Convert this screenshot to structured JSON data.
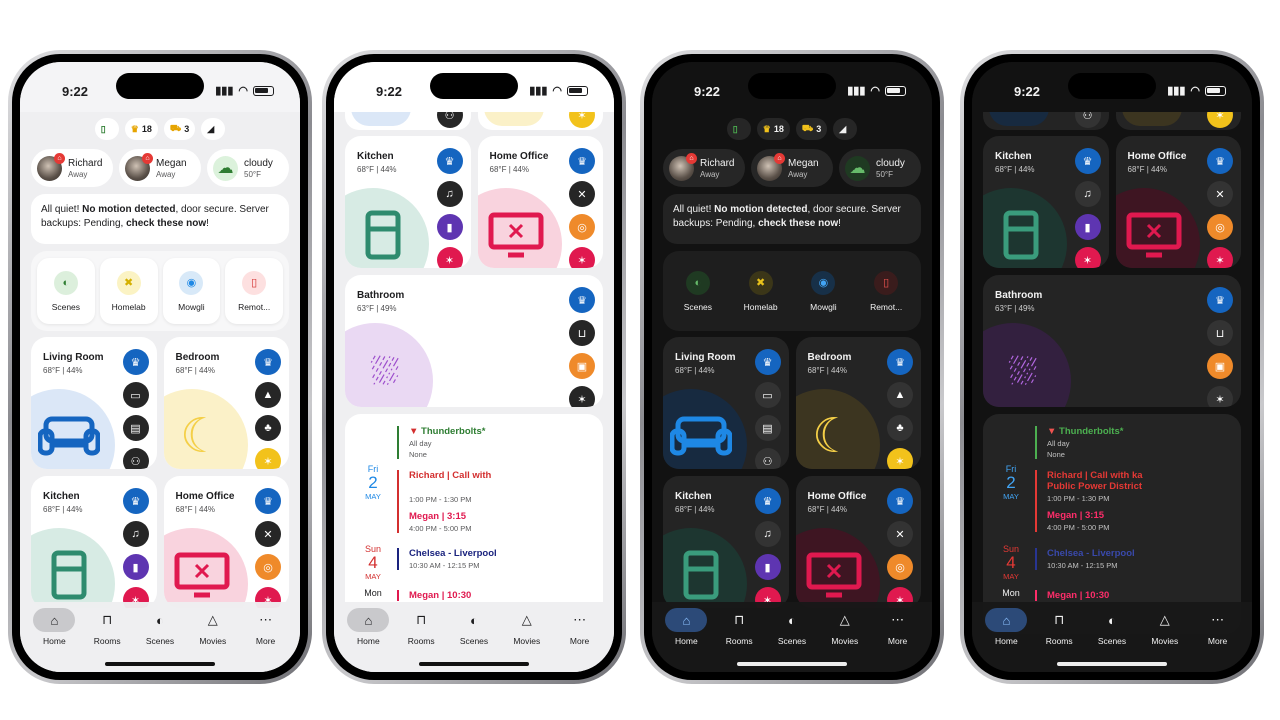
{
  "status": {
    "time": "9:22"
  },
  "chips": [
    {
      "icon": "door-sensor-icon",
      "value": ""
    },
    {
      "icon": "crown-icon",
      "value": "18"
    },
    {
      "icon": "cart-icon",
      "value": "3"
    },
    {
      "icon": "camera-icon",
      "value": ""
    }
  ],
  "people": [
    {
      "name": "Richard",
      "state": "Away"
    },
    {
      "name": "Megan",
      "state": "Away"
    }
  ],
  "weather": {
    "condition": "cloudy",
    "temp": "50°F"
  },
  "notice": {
    "t1": "All quiet! ",
    "b1": "No motion detected",
    "t2": ", door secure. Server backups: Pending, ",
    "b2": "check these now",
    "t3": "!"
  },
  "scenes": [
    "Scenes",
    "Homelab",
    "Mowgli",
    "Remot..."
  ],
  "rooms": [
    {
      "name": "Living Room",
      "info": "68°F | 44%"
    },
    {
      "name": "Bedroom",
      "info": "68°F | 44%"
    },
    {
      "name": "Kitchen",
      "info": "68°F | 44%"
    },
    {
      "name": "Home Office",
      "info": "68°F | 44%"
    },
    {
      "name": "Bathroom",
      "info": "63°F | 49%"
    }
  ],
  "calendar": {
    "day1": {
      "dow": "Fri",
      "num": "2",
      "mon": "MAY"
    },
    "day2": {
      "dow": "Sun",
      "num": "4",
      "mon": "MAY"
    },
    "day3": {
      "dow": "Mon"
    },
    "movie": {
      "title": "Thunderbolts*",
      "when": "All day",
      "loc": "None"
    },
    "richard_call": "Richard | Call with",
    "richard_call_dark": "Richard | Call with ka Public Power District",
    "richard_time": "1:00 PM - 1:30 PM",
    "megan_315": "Megan | 3:15",
    "megan_315_time": "4:00 PM - 5:00 PM",
    "chelsea": "Chelsea - Liverpool",
    "chelsea_time": "10:30 AM - 12:15 PM",
    "megan_1030": "Megan | 10:30"
  },
  "nav": [
    "Home",
    "Rooms",
    "Scenes",
    "Movies",
    "More"
  ],
  "colors": {
    "accent_blue": "#1565c0",
    "red": "#e0194f",
    "green": "#2e7d32"
  }
}
